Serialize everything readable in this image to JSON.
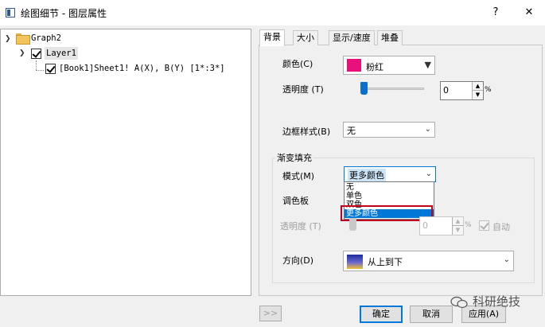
{
  "window": {
    "title": "绘图细节 - 图层属性",
    "help_label": "?",
    "close_label": "✕"
  },
  "tree": {
    "graph": "Graph2",
    "layer": "Layer1",
    "plot": "[Book1]Sheet1! A(X), B(Y) [1*:3*]"
  },
  "tabs": [
    {
      "label": "背景",
      "active": true
    },
    {
      "label": "大小",
      "active": false
    },
    {
      "label": "显示/速度",
      "active": false
    },
    {
      "label": "堆叠",
      "active": false
    }
  ],
  "background": {
    "color_label": "颜色(C)",
    "color_value": "粉红",
    "color_hex": "#e8117b",
    "transparency_label": "透明度 (T)",
    "transparency_value": "0",
    "transparency_percent": 0,
    "transparency_unit": "%",
    "border_label": "边框样式(B)",
    "border_value": "无"
  },
  "gradient": {
    "group_label": "渐变填充",
    "mode_label": "模式(M)",
    "mode_value": "更多颜色",
    "mode_options": [
      "无",
      "单色",
      "双色",
      "更多颜色"
    ],
    "mode_selected_index": 3,
    "palette_label": "调色板",
    "transparency_label": "透明度 (T)",
    "transparency_value": "0",
    "transparency_unit": "%",
    "auto_label": "自动",
    "direction_label": "方向(D)",
    "direction_value": "从上到下"
  },
  "buttons": {
    "expand": ">>",
    "ok": "确定",
    "cancel": "取消",
    "apply": "应用(A)"
  },
  "watermark": "科研绝技",
  "colors": {
    "accent": "#0078d7",
    "highlight": "#c0001a",
    "pink": "#e8117b"
  }
}
